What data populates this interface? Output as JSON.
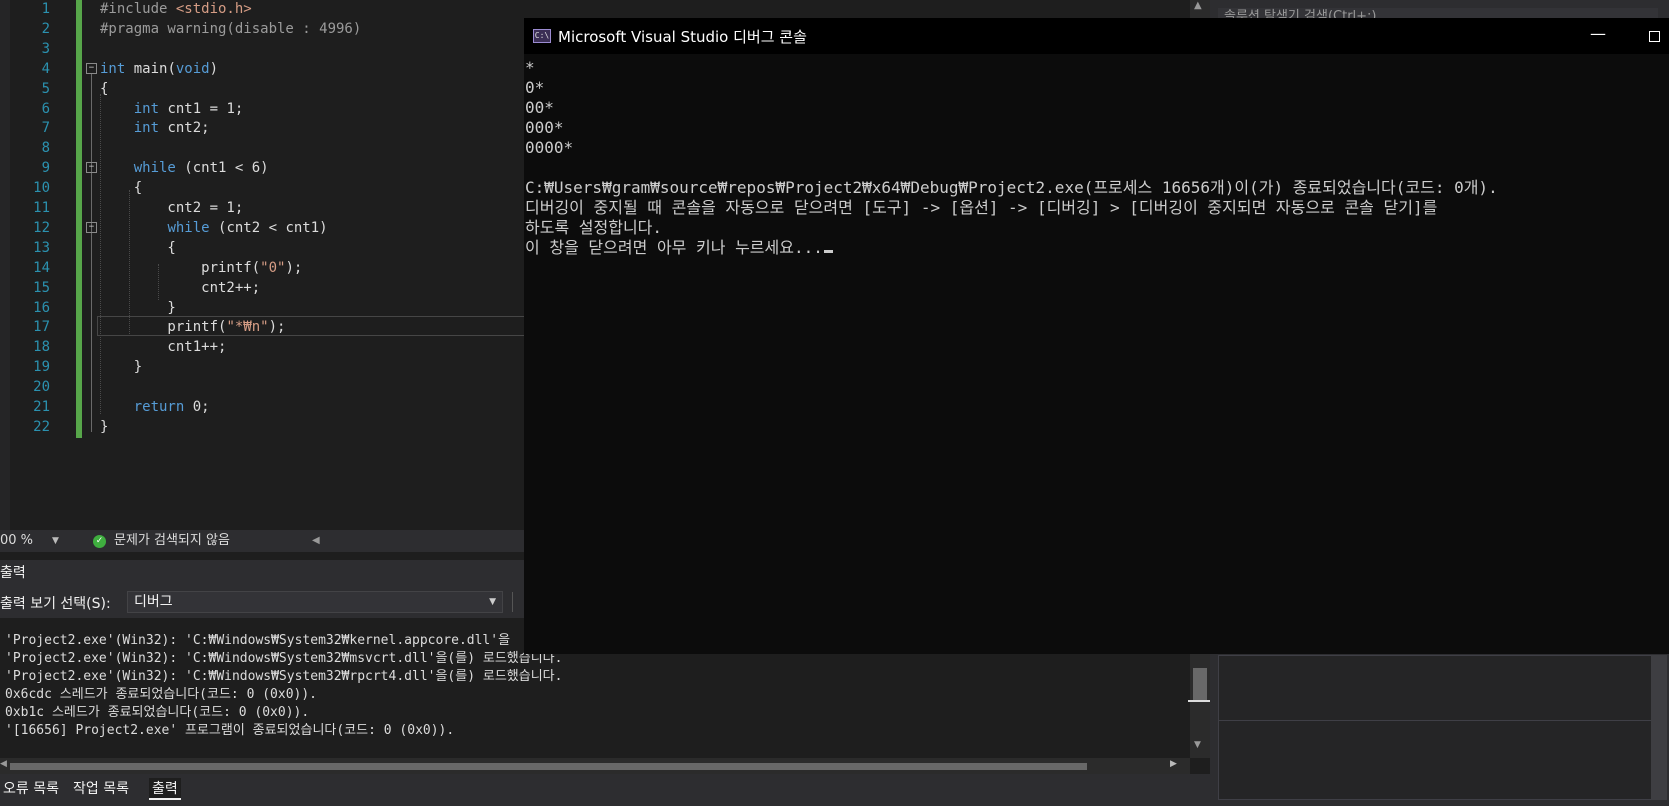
{
  "editor": {
    "lines": [
      {
        "n": "1",
        "parts": [
          {
            "t": "#include ",
            "c": "pp"
          },
          {
            "t": "<stdio.h>",
            "c": "str"
          }
        ]
      },
      {
        "n": "2",
        "parts": [
          {
            "t": "#pragma warning(disable : 4996)",
            "c": "pp"
          }
        ]
      },
      {
        "n": "3",
        "parts": []
      },
      {
        "n": "4",
        "parts": [
          {
            "t": "int",
            "c": "kw"
          },
          {
            "t": " main(",
            "c": ""
          },
          {
            "t": "void",
            "c": "kw"
          },
          {
            "t": ")",
            "c": ""
          }
        ]
      },
      {
        "n": "5",
        "parts": [
          {
            "t": "{",
            "c": ""
          }
        ]
      },
      {
        "n": "6",
        "parts": [
          {
            "t": "    ",
            "c": ""
          },
          {
            "t": "int",
            "c": "kw"
          },
          {
            "t": " cnt1 = 1;",
            "c": ""
          }
        ]
      },
      {
        "n": "7",
        "parts": [
          {
            "t": "    ",
            "c": ""
          },
          {
            "t": "int",
            "c": "kw"
          },
          {
            "t": " cnt2;",
            "c": ""
          }
        ]
      },
      {
        "n": "8",
        "parts": []
      },
      {
        "n": "9",
        "parts": [
          {
            "t": "    ",
            "c": ""
          },
          {
            "t": "while",
            "c": "kw"
          },
          {
            "t": " (cnt1 < 6)",
            "c": ""
          }
        ]
      },
      {
        "n": "10",
        "parts": [
          {
            "t": "    {",
            "c": ""
          }
        ]
      },
      {
        "n": "11",
        "parts": [
          {
            "t": "        cnt2 = 1;",
            "c": ""
          }
        ]
      },
      {
        "n": "12",
        "parts": [
          {
            "t": "        ",
            "c": ""
          },
          {
            "t": "while",
            "c": "kw"
          },
          {
            "t": " (cnt2 < cnt1)",
            "c": ""
          }
        ]
      },
      {
        "n": "13",
        "parts": [
          {
            "t": "        {",
            "c": ""
          }
        ]
      },
      {
        "n": "14",
        "parts": [
          {
            "t": "            printf(",
            "c": ""
          },
          {
            "t": "\"0\"",
            "c": "str"
          },
          {
            "t": ");",
            "c": ""
          }
        ]
      },
      {
        "n": "15",
        "parts": [
          {
            "t": "            cnt2++;",
            "c": ""
          }
        ]
      },
      {
        "n": "16",
        "parts": [
          {
            "t": "        }",
            "c": ""
          }
        ]
      },
      {
        "n": "17",
        "parts": [
          {
            "t": "        printf(",
            "c": ""
          },
          {
            "t": "\"*₩n\"",
            "c": "str"
          },
          {
            "t": ");",
            "c": ""
          }
        ]
      },
      {
        "n": "18",
        "parts": [
          {
            "t": "        cnt1++;",
            "c": ""
          }
        ]
      },
      {
        "n": "19",
        "parts": [
          {
            "t": "    }",
            "c": ""
          }
        ]
      },
      {
        "n": "20",
        "parts": []
      },
      {
        "n": "21",
        "parts": [
          {
            "t": "    ",
            "c": ""
          },
          {
            "t": "return",
            "c": "kw"
          },
          {
            "t": " 0;",
            "c": ""
          }
        ]
      },
      {
        "n": "22",
        "parts": [
          {
            "t": "}",
            "c": ""
          }
        ]
      }
    ],
    "fold_lines": [
      "4",
      "9",
      "12"
    ]
  },
  "status": {
    "zoom": "00 %",
    "issues": "문제가 검색되지 않음"
  },
  "output": {
    "header": "출력",
    "source_label": "출력 보기 선택(S):",
    "source_value": "디버그",
    "lines": [
      "'Project2.exe'(Win32): 'C:₩Windows₩System32₩kernel.appcore.dll'을",
      "'Project2.exe'(Win32): 'C:₩Windows₩System32₩msvcrt.dll'을(를) 로드했습니다.",
      "'Project2.exe'(Win32): 'C:₩Windows₩System32₩rpcrt4.dll'을(를) 로드했습니다.",
      "0x6cdc 스레드가 종료되었습니다(코드: 0 (0x0)).",
      "0xb1c 스레드가 종료되었습니다(코드: 0 (0x0)).",
      "'[16656] Project2.exe' 프로그램이 종료되었습니다(코드: 0 (0x0))."
    ]
  },
  "tabs": [
    "오류 목록",
    "작업 목록",
    "출력"
  ],
  "right_panel": {
    "search_placeholder": "솔루션 탐색기 검색(Ctrl+;)"
  },
  "console": {
    "icon_text": "C:\\",
    "title": "Microsoft Visual Studio 디버그 콘솔",
    "lines": [
      "*",
      "0*",
      "00*",
      "000*",
      "0000*",
      "",
      "C:₩Users₩gram₩source₩repos₩Project2₩x64₩Debug₩Project2.exe(프로세스 16656개)이(가) 종료되었습니다(코드: 0개).",
      "디버깅이 중지될 때 콘솔을 자동으로 닫으려면 [도구] -> [옵션] -> [디버깅] > [디버깅이 중지되면 자동으로 콘솔 닫기]를",
      "하도록 설정합니다.",
      "이 창을 닫으려면 아무 키나 누르세요..."
    ]
  }
}
